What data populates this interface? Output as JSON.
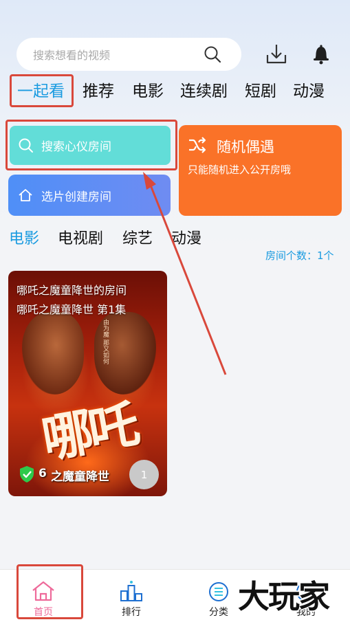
{
  "header": {
    "search_placeholder": "搜索想看的视频",
    "icons": [
      "search-icon",
      "download-icon",
      "bell-icon"
    ]
  },
  "top_tabs": [
    {
      "label": "一起看",
      "active": true
    },
    {
      "label": "推荐",
      "active": false
    },
    {
      "label": "电影",
      "active": false
    },
    {
      "label": "连续剧",
      "active": false
    },
    {
      "label": "短剧",
      "active": false
    },
    {
      "label": "动漫",
      "active": false
    }
  ],
  "room_actions": {
    "search_room_label": "搜索心仪房间",
    "create_room_label": "选片创建房间",
    "random_title": "随机偶遇",
    "random_subtitle": "只能随机进入公开房哦"
  },
  "category_tabs": [
    {
      "label": "电影",
      "active": true
    },
    {
      "label": "电视剧",
      "active": false
    },
    {
      "label": "综艺",
      "active": false
    },
    {
      "label": "动漫",
      "active": false
    }
  ],
  "room_count": "房间个数：1个",
  "rooms": [
    {
      "room_name": "哪吒之魔童降世的房间",
      "episode": "哪吒之魔童降世 第1集",
      "poster_title_art": "哪吒",
      "poster_subtitle": "之魔童降世",
      "poster_credit": "由为魔 那又如何",
      "verified_count_fragment": "6",
      "viewer_count": "1"
    }
  ],
  "bottom_nav": [
    {
      "label": "首页",
      "icon": "home-icon",
      "active": true
    },
    {
      "label": "排行",
      "icon": "ranking-icon",
      "active": false
    },
    {
      "label": "分类",
      "icon": "category-icon",
      "active": false
    },
    {
      "label": "我的",
      "icon": "profile-icon",
      "active": false
    }
  ],
  "watermark": "大玩家",
  "colors": {
    "accent_blue": "#1a9be0",
    "teal": "#62ddd8",
    "orange": "#fa7228",
    "active_pink": "#ee6a9a",
    "annotation_red": "#d9483b"
  }
}
